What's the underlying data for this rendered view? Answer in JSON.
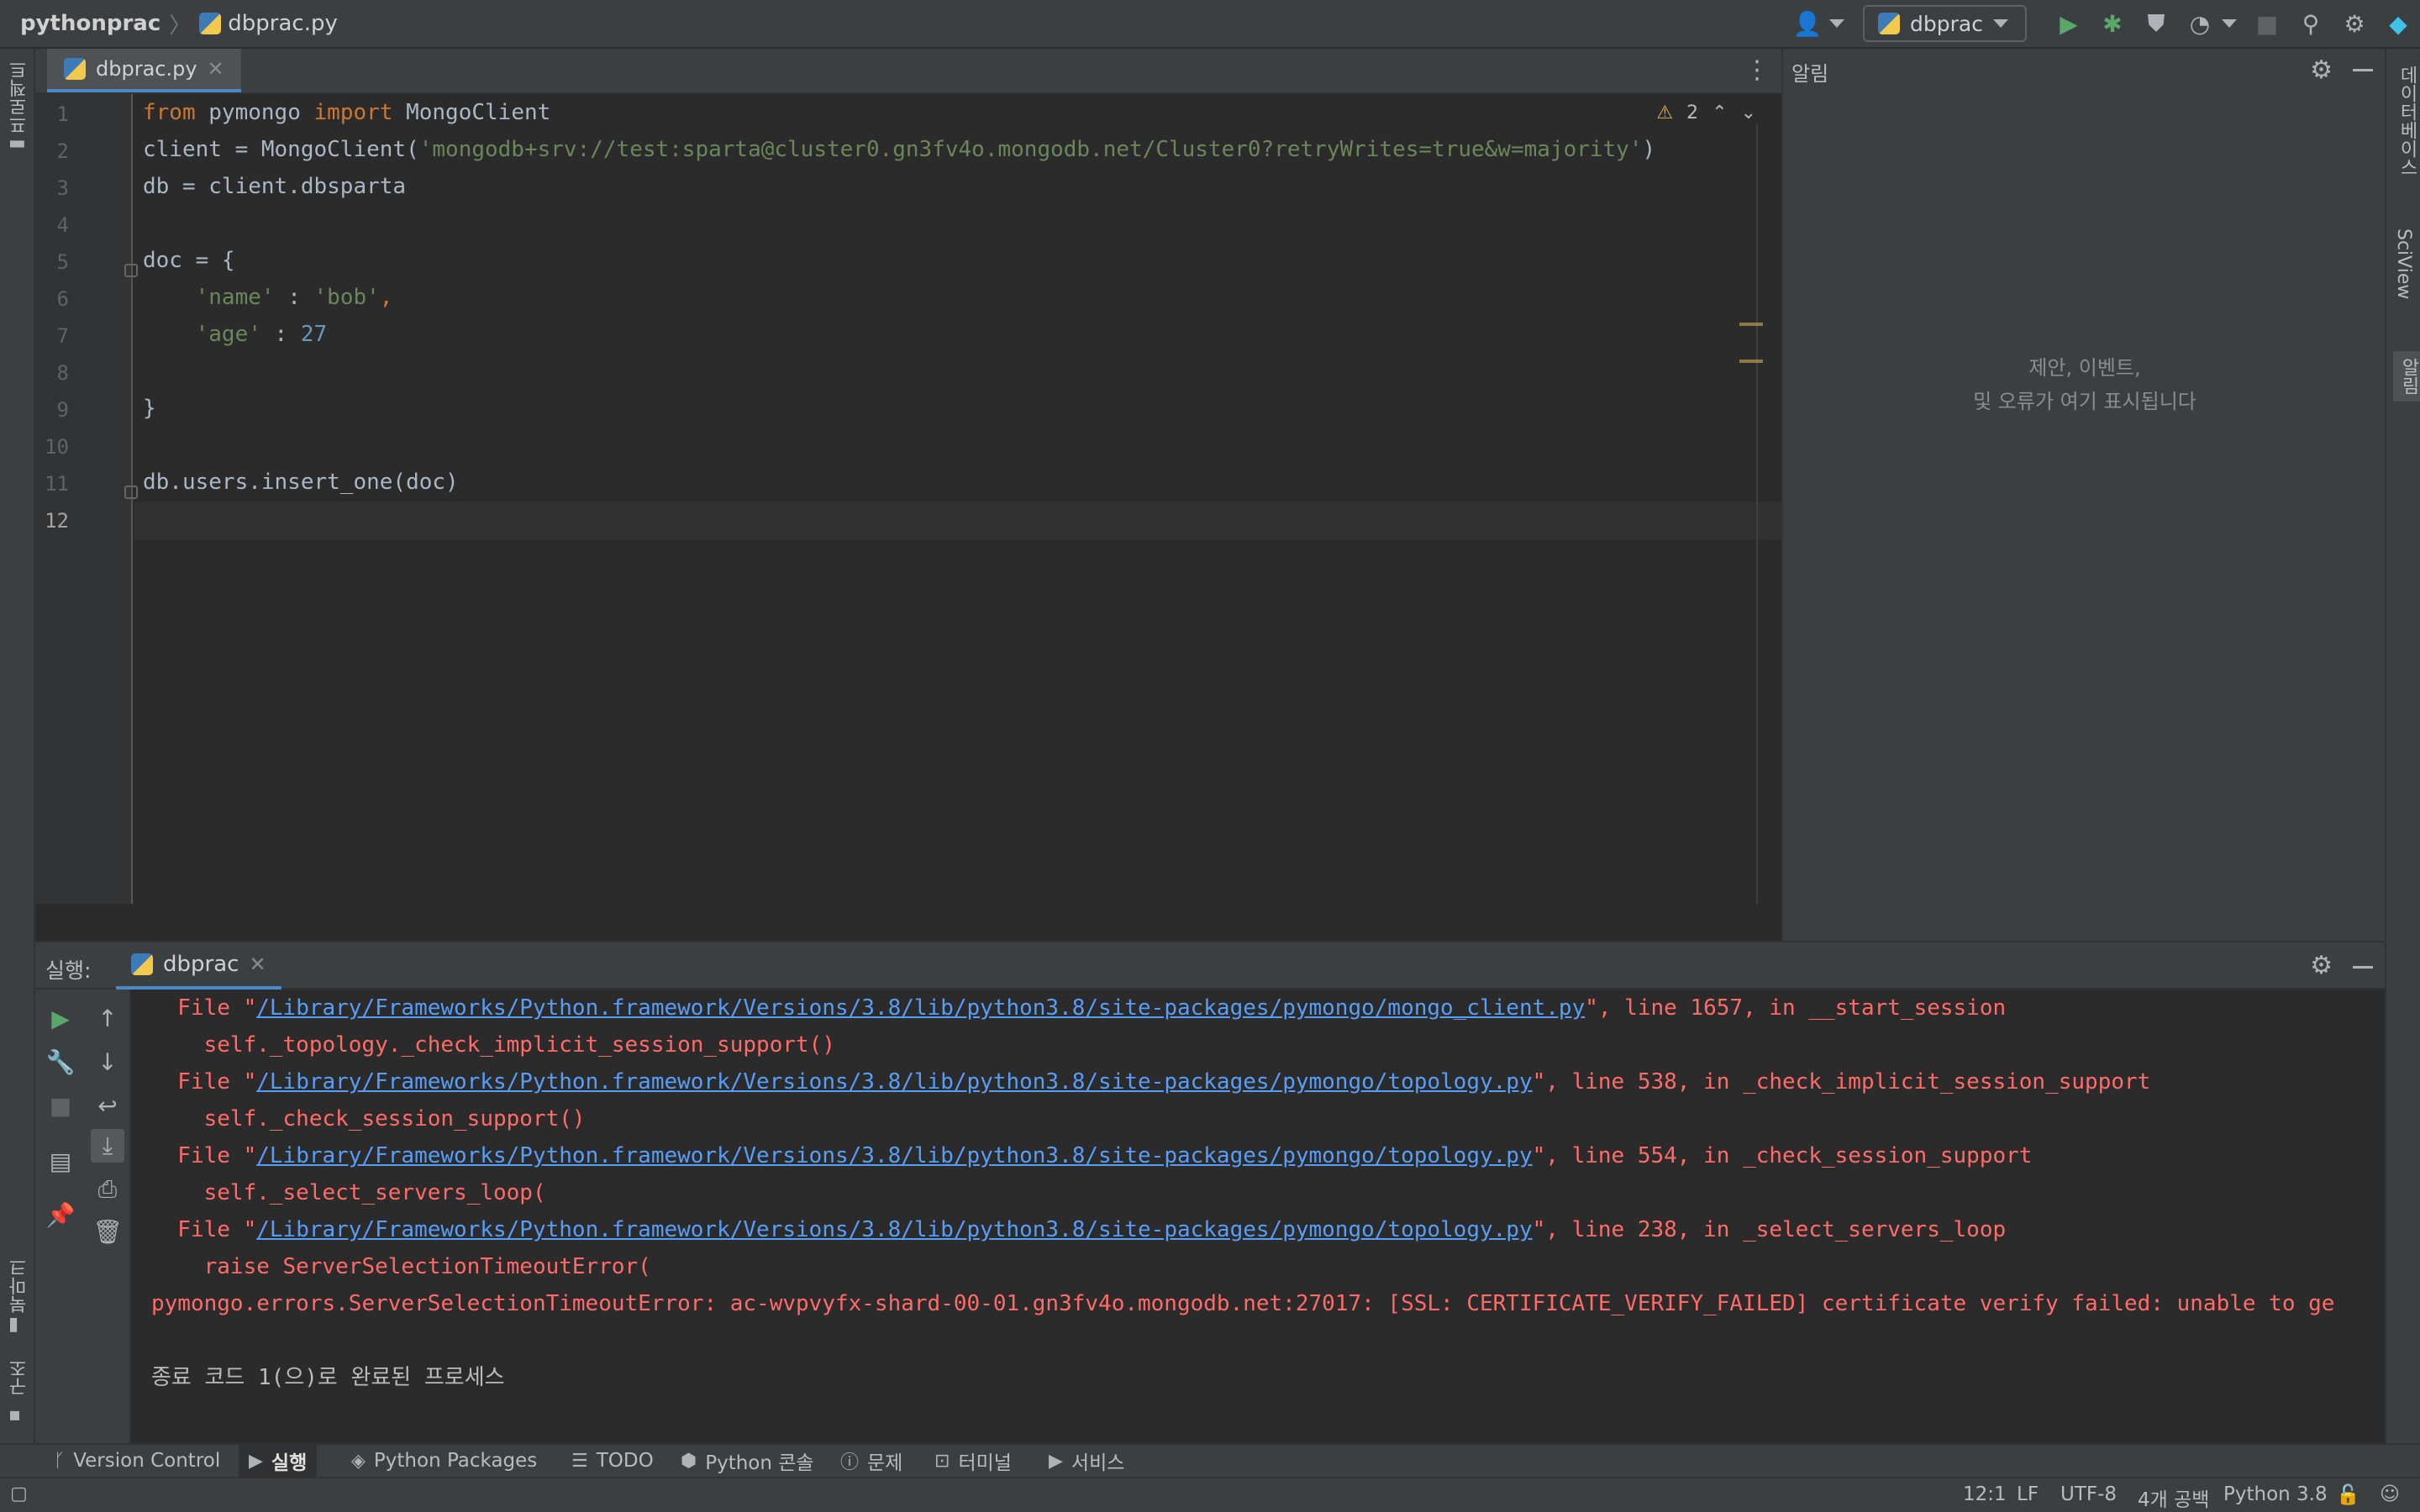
{
  "titlebar": {
    "project": "pythonprac",
    "file": "dbprac.py",
    "run_config": "dbprac"
  },
  "left_strip": {
    "project_label": "프로젝트",
    "bookmarks_label": "북마크",
    "structure_label": "구조"
  },
  "right_strip": {
    "database_label": "데이터베이스",
    "sciview_label": "SciView",
    "notifications_label": "알림"
  },
  "editor": {
    "tab_label": "dbprac.py",
    "warning_count": "2",
    "current_line": 12,
    "lines": [
      {
        "n": "1",
        "parts": [
          {
            "t": "from",
            "c": "kw"
          },
          {
            "t": " pymongo ",
            "c": ""
          },
          {
            "t": "import",
            "c": "kw"
          },
          {
            "t": " MongoClient",
            "c": ""
          }
        ]
      },
      {
        "n": "2",
        "parts": [
          {
            "t": "client = MongoClient(",
            "c": ""
          },
          {
            "t": "'mongodb+srv://test:sparta@cluster0.gn3fv4o.mongodb.net/Cluster0?retryWrites=true&w=majority'",
            "c": "str"
          },
          {
            "t": ")",
            "c": ""
          }
        ]
      },
      {
        "n": "3",
        "parts": [
          {
            "t": "db = client.dbsparta",
            "c": ""
          }
        ]
      },
      {
        "n": "4",
        "parts": []
      },
      {
        "n": "5",
        "parts": [
          {
            "t": "doc = {",
            "c": ""
          }
        ]
      },
      {
        "n": "6",
        "parts": [
          {
            "t": "    ",
            "c": ""
          },
          {
            "t": "'name'",
            "c": "str"
          },
          {
            "t": " : ",
            "c": ""
          },
          {
            "t": "'bob'",
            "c": "str"
          },
          {
            "t": ",",
            "c": "kw"
          }
        ]
      },
      {
        "n": "7",
        "parts": [
          {
            "t": "    ",
            "c": ""
          },
          {
            "t": "'age'",
            "c": "str"
          },
          {
            "t": " : ",
            "c": ""
          },
          {
            "t": "27",
            "c": "num"
          }
        ]
      },
      {
        "n": "8",
        "parts": []
      },
      {
        "n": "9",
        "parts": [
          {
            "t": "}",
            "c": ""
          }
        ]
      },
      {
        "n": "10",
        "parts": []
      },
      {
        "n": "11",
        "parts": [
          {
            "t": "db.users.insert_one(doc)",
            "c": ""
          }
        ]
      },
      {
        "n": "12",
        "parts": []
      }
    ]
  },
  "notifications": {
    "title": "알림",
    "empty_line1": "제안, 이벤트,",
    "empty_line2": "및 오류가 여기 표시됩니다"
  },
  "run_panel": {
    "label": "실행:",
    "tab_label": "dbprac",
    "console": [
      {
        "kind": "file",
        "prefix": "  File \"",
        "link": "/Library/Frameworks/Python.framework/Versions/3.8/lib/python3.8/site-packages/pymongo/mongo_client.py",
        "suffix": "\", line 1657, in __start_session"
      },
      {
        "kind": "text",
        "text": "    self._topology._check_implicit_session_support()"
      },
      {
        "kind": "file",
        "prefix": "  File \"",
        "link": "/Library/Frameworks/Python.framework/Versions/3.8/lib/python3.8/site-packages/pymongo/topology.py",
        "suffix": "\", line 538, in _check_implicit_session_support"
      },
      {
        "kind": "text",
        "text": "    self._check_session_support()"
      },
      {
        "kind": "file",
        "prefix": "  File \"",
        "link": "/Library/Frameworks/Python.framework/Versions/3.8/lib/python3.8/site-packages/pymongo/topology.py",
        "suffix": "\", line 554, in _check_session_support"
      },
      {
        "kind": "text",
        "text": "    self._select_servers_loop("
      },
      {
        "kind": "file",
        "prefix": "  File \"",
        "link": "/Library/Frameworks/Python.framework/Versions/3.8/lib/python3.8/site-packages/pymongo/topology.py",
        "suffix": "\", line 238, in _select_servers_loop"
      },
      {
        "kind": "text",
        "text": "    raise ServerSelectionTimeoutError("
      },
      {
        "kind": "text",
        "text": "pymongo.errors.ServerSelectionTimeoutError: ac-wvpvyfx-shard-00-01.gn3fv4o.mongodb.net:27017: [SSL: CERTIFICATE_VERIFY_FAILED] certificate verify failed: unable to ge"
      },
      {
        "kind": "blank",
        "text": ""
      },
      {
        "kind": "plain",
        "text": "종료 코드 1(으)로 완료된 프로세스"
      }
    ]
  },
  "toolwindows": [
    {
      "label": "Version Control",
      "icon": "branch-icon",
      "glyph": "ᚴ"
    },
    {
      "label": "실행",
      "icon": "play-icon",
      "glyph": "▶",
      "active": true
    },
    {
      "label": "Python Packages",
      "icon": "layers-icon",
      "glyph": "◈"
    },
    {
      "label": "TODO",
      "icon": "list-icon",
      "glyph": "☰"
    },
    {
      "label": "Python 콘솔",
      "icon": "python-icon",
      "glyph": "⬢"
    },
    {
      "label": "문제",
      "icon": "info-icon",
      "glyph": "ⓘ"
    },
    {
      "label": "터미널",
      "icon": "terminal-icon",
      "glyph": "⊡"
    },
    {
      "label": "서비스",
      "icon": "services-icon",
      "glyph": "▶"
    }
  ],
  "statusbar": {
    "position": "12:1",
    "line_sep": "LF",
    "encoding": "UTF-8",
    "indent": "4개 공백",
    "interpreter": "Python 3.8"
  },
  "colors": {
    "keyword": "#cc7832",
    "string": "#6a8759",
    "number": "#6897bb",
    "error": "#ff6b68",
    "link": "#589df6",
    "accent": "#4a88c7",
    "run_green": "#59a869"
  }
}
